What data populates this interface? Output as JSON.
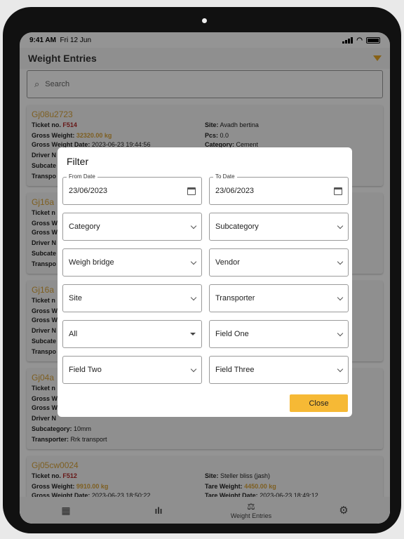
{
  "status": {
    "time": "9:41 AM",
    "date": "Fri 12 Jun"
  },
  "header": {
    "title": "Weight Entries"
  },
  "search": {
    "placeholder": "Search"
  },
  "cards": [
    {
      "title": "Gj08u2723",
      "ticket_label": "Ticket no.",
      "ticket": "F514",
      "gross_label": "Gross Weight:",
      "gross": "32320.00 kg",
      "gdate_label": "Gross Weight Date:",
      "gdate": "2023-06-23 19:44:56",
      "driver_label": "Driver N",
      "subcat_label": "Subcate",
      "transp_label": "Transpo",
      "site_label": "Site:",
      "site": "Avadh bertina",
      "pcs_label": "Pcs:",
      "pcs": "0.0",
      "cat_label": "Category:",
      "cat": "Cement"
    },
    {
      "title": "Gj16a",
      "ticket_label": "Ticket n",
      "gross_label": "Gross W",
      "gdate_label": "Gross W",
      "driver_label": "Driver N",
      "subcat_label": "Subcate",
      "transp_label": "Transpo"
    },
    {
      "title": "Gj16a",
      "ticket_label": "Ticket n",
      "gross_label": "Gross W",
      "gdate_label": "Gross W",
      "driver_label": "Driver N",
      "subcat_label": "Subcate",
      "transp_label": "Transpo"
    },
    {
      "title": "Gj04a",
      "ticket_label": "Ticket n",
      "gross_label": "Gross W",
      "gdate_label": "Gross W",
      "driver_label": "Driver N",
      "subcat_label": "Subcategory:",
      "subcat": "10mm",
      "transp_label": "Transporter:",
      "transp": "Rrk transport"
    },
    {
      "title": "Gj05cw0024",
      "ticket_label": "Ticket no.",
      "ticket": "F512",
      "gross_label": "Gross Weight:",
      "gross": "9910.00 kg",
      "gdate_label": "Gross Weight Date:",
      "gdate": "2023-06-23 18:50:22",
      "site_label": "Site:",
      "site": "Steller bliss (jash)",
      "tare_label": "Tare Weight:",
      "tare": "4450.00 kg",
      "tdate_label": "Tare Weight Date:",
      "tdate": "2023-06-23 18:49:12"
    }
  ],
  "nav": {
    "active_label": "Weight Entries"
  },
  "filter": {
    "title": "Filter",
    "from_label": "From Date",
    "from": "23/06/2023",
    "to_label": "To Date",
    "to": "23/06/2023",
    "category": "Category",
    "subcategory": "Subcategory",
    "weighbridge": "Weigh bridge",
    "vendor": "Vendor",
    "site": "Site",
    "transporter": "Transporter",
    "all": "All",
    "field_one": "Field One",
    "field_two": "Field Two",
    "field_three": "Field Three",
    "close": "Close"
  },
  "colors": {
    "accent": "#f6b935",
    "title_gold": "#d9a43a",
    "ticket_red": "#b12a2a"
  }
}
